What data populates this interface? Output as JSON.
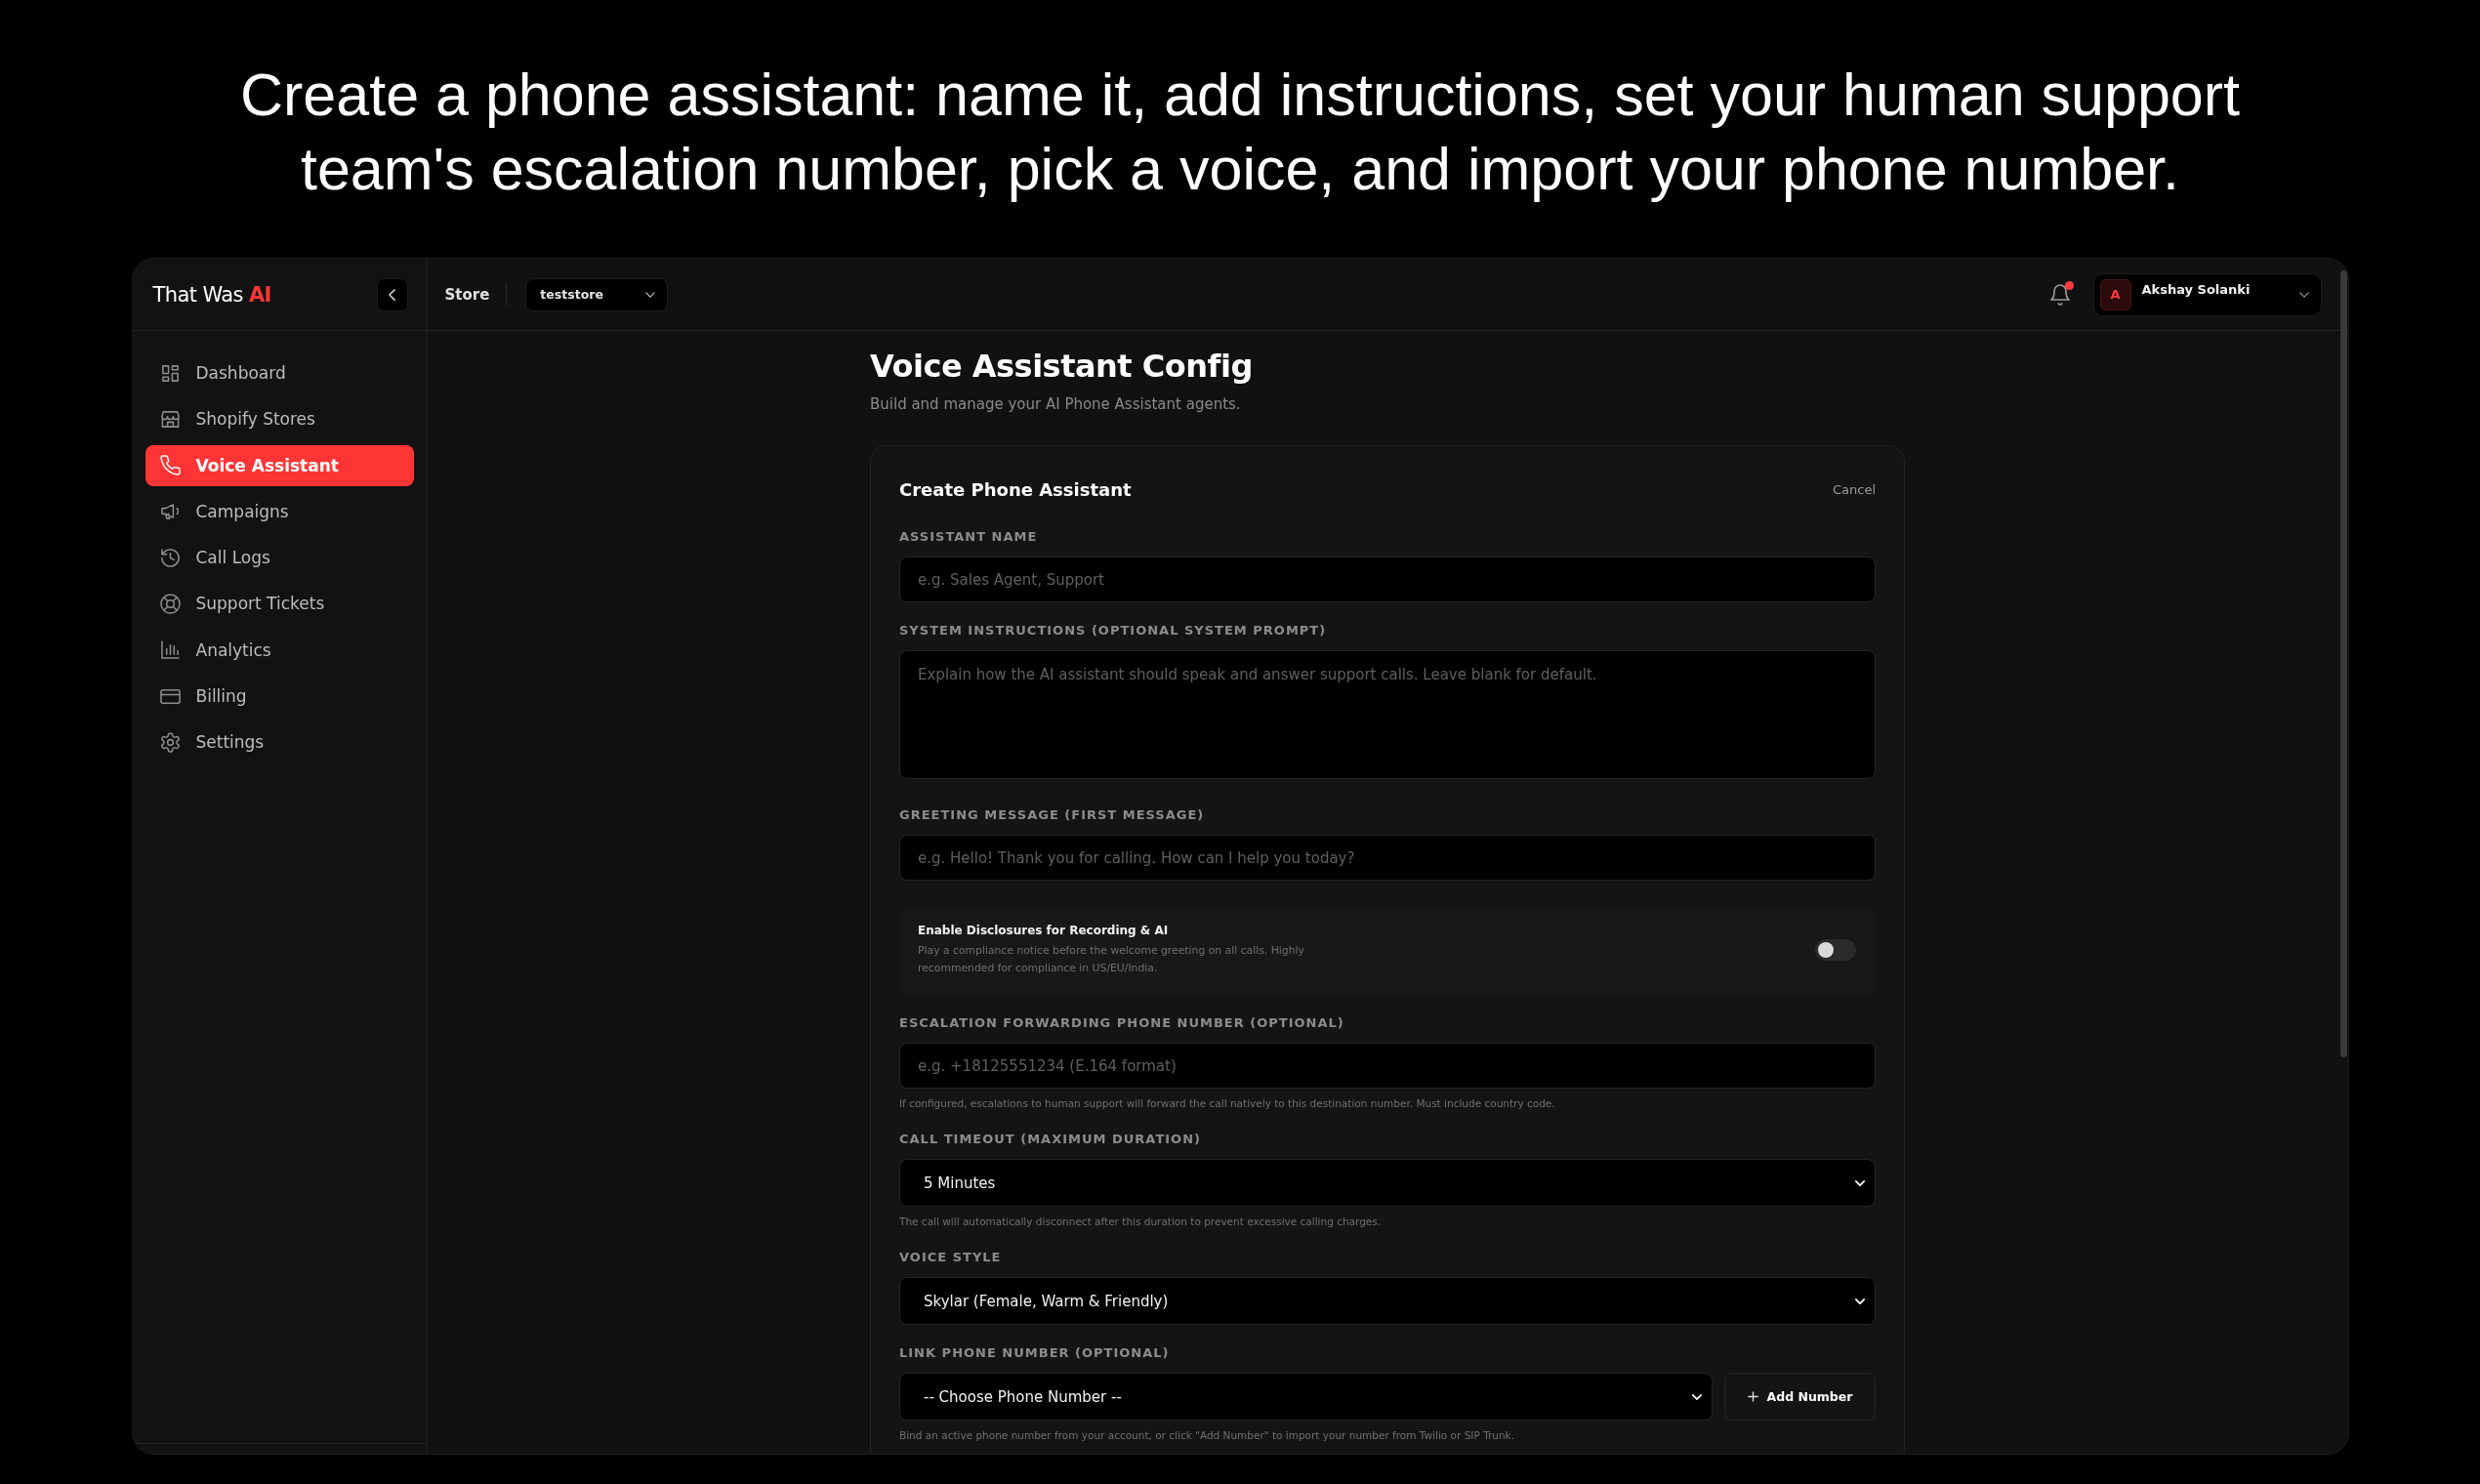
{
  "caption": "Create a phone assistant: name it, add instructions, set your human support team's escalation number, pick a voice, and import your phone number.",
  "sidebar": {
    "logo": {
      "text": "That Was",
      "accent": "AI"
    },
    "items": [
      {
        "label": "Dashboard",
        "selected": false
      },
      {
        "label": "Shopify Stores",
        "selected": false
      },
      {
        "label": "Voice Assistant",
        "selected": true
      },
      {
        "label": "Campaigns",
        "selected": false
      },
      {
        "label": "Call Logs",
        "selected": false
      },
      {
        "label": "Support Tickets",
        "selected": false
      },
      {
        "label": "Analytics",
        "selected": false
      },
      {
        "label": "Billing",
        "selected": false
      },
      {
        "label": "Settings",
        "selected": false
      }
    ]
  },
  "header": {
    "store_label": "Store",
    "store_select": {
      "value": "teststore"
    },
    "notifications": {
      "unread": true
    },
    "user": {
      "initial": "A",
      "name": "Akshay Solanki"
    }
  },
  "page": {
    "title": "Voice Assistant Config",
    "subtitle": "Build and manage your AI Phone Assistant agents."
  },
  "form": {
    "title": "Create Phone Assistant",
    "cancel": "Cancel",
    "fields": [
      {
        "kind": "input",
        "label": "ASSISTANT NAME",
        "placeholder": "e.g. Sales Agent, Support"
      },
      {
        "kind": "textarea",
        "label": "SYSTEM INSTRUCTIONS (OPTIONAL SYSTEM PROMPT)",
        "placeholder": "Explain how the AI assistant should speak and answer support calls. Leave blank for default."
      },
      {
        "kind": "input",
        "label": "GREETING MESSAGE (FIRST MESSAGE)",
        "placeholder": "e.g. Hello! Thank you for calling. How can I help you today?"
      },
      {
        "kind": "toggle",
        "title": "Enable Disclosures for Recording & AI",
        "description": "Play a compliance notice before the welcome greeting on all calls. Highly recommended for compliance in US/EU/India.",
        "on": false
      },
      {
        "kind": "input",
        "label": "ESCALATION FORWARDING PHONE NUMBER (OPTIONAL)",
        "placeholder": "e.g. +18125551234 (E.164 format)",
        "help": "If configured, escalations to human support will forward the call natively to this destination number. Must include country code."
      },
      {
        "kind": "select",
        "label": "CALL TIMEOUT (MAXIMUM DURATION)",
        "value": "5 Minutes",
        "help": "The call will automatically disconnect after this duration to prevent excessive calling charges."
      },
      {
        "kind": "select",
        "label": "VOICE STYLE",
        "value": "Skylar (Female, Warm & Friendly)"
      },
      {
        "kind": "select",
        "label": "LINK PHONE NUMBER (OPTIONAL)",
        "value": "-- Choose Phone Number --",
        "button": "Add Number",
        "help": "Bind an active phone number from your account, or click \"Add Number\" to import your number from Twilio or SIP Trunk."
      }
    ]
  }
}
